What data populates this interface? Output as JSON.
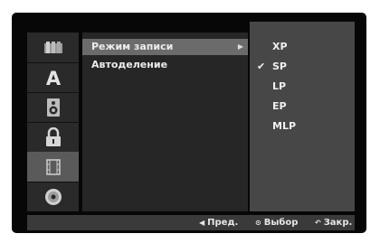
{
  "sidebar": {
    "items": [
      {
        "icon": "film-frames-icon"
      },
      {
        "icon": "letter-a-icon"
      },
      {
        "icon": "speaker-icon"
      },
      {
        "icon": "padlock-icon"
      },
      {
        "icon": "film-strip-icon",
        "active": true
      },
      {
        "icon": "disc-icon"
      }
    ]
  },
  "options": {
    "items": [
      {
        "label": "Режим записи",
        "active": true,
        "has_submenu": true
      },
      {
        "label": "Автоделение"
      }
    ]
  },
  "values": {
    "items": [
      {
        "label": "XP"
      },
      {
        "label": "SP",
        "checked": true
      },
      {
        "label": "LP"
      },
      {
        "label": "EP"
      },
      {
        "label": "MLP"
      }
    ],
    "check_glyph": "✔"
  },
  "hints": {
    "prev_icon": "◀",
    "prev_label": "Пред.",
    "select_icon": "⊙",
    "select_label": "Выбор",
    "close_icon": "↶",
    "close_label": "Закр."
  },
  "colors": {
    "screen_bg": "#070707",
    "active_option": "#6b6b6b",
    "values_bg": "#474747",
    "text": "#ececec"
  }
}
